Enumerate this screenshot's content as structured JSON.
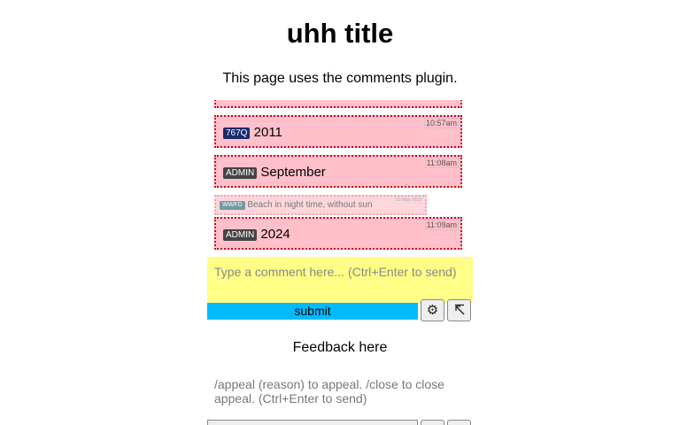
{
  "page": {
    "title": "uhh title",
    "subtitle": "This page uses the comments plugin."
  },
  "comments": [
    {
      "badge": "767Q",
      "badge_color": "#1a2a6c",
      "text": "2011",
      "time": "10:57am"
    },
    {
      "badge": "ADMIN",
      "badge_color": "#444444",
      "text": "September",
      "time": "11:08am"
    },
    {
      "badge": "WWFD",
      "badge_color": "#6f9aa0",
      "text": "Beach in night time, without sun",
      "time": "03 May 2023"
    },
    {
      "badge": "ADMIN",
      "badge_color": "#444444",
      "text": "2024",
      "time": "11:09am"
    }
  ],
  "comment_input": {
    "placeholder": "Type a comment here... (Ctrl+Enter to send)",
    "submit_label": "submit",
    "settings_icon": "gear-icon",
    "expand_icon": "expand-arrow-icon"
  },
  "feedback": {
    "title": "Feedback here",
    "placeholder": "/appeal (reason) to appeal. /close to close appeal. (Ctrl+Enter to send)"
  },
  "colors": {
    "comment_bg": "#ffc0cb",
    "comment_border": "#d0001b",
    "input_bg": "#ffff88",
    "submit_bg": "#00bbff"
  }
}
